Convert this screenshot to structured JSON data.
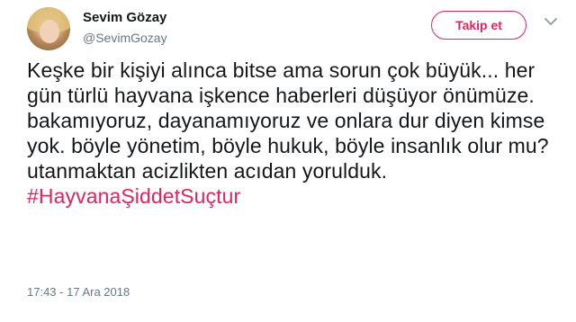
{
  "user": {
    "display_name": "Sevim Gözay",
    "handle": "@SevimGozay",
    "avatar_icon": "profile-photo"
  },
  "actions": {
    "follow_label": "Takip et",
    "more_icon": "chevron-down-icon"
  },
  "tweet": {
    "text": "Keşke bir kişiyi alınca bitse ama sorun çok büyük... her gün türlü hayvana işkence haberleri düşüyor önümüze. bakamıyoruz, dayanamıyoruz ve onlara dur diyen kimse yok. böyle yönetim, böyle hukuk, böyle insanlık olur mu? utanmaktan acizlikten acıdan yorulduk. ",
    "hashtag": "#HayvanaŞiddetSuçtur",
    "timestamp": "17:43 - 17 Ara 2018"
  },
  "colors": {
    "accent": "#e0245e",
    "secondary_text": "#657786",
    "primary_text": "#14171a"
  }
}
